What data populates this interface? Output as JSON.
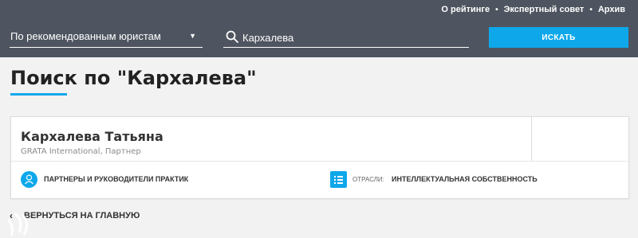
{
  "top_links": [
    "О рейтинге",
    "Экспертный совет",
    "Архив"
  ],
  "search_bar": {
    "filter_value": "По рекомендованным юристам",
    "query": "Кархалева",
    "button_label": "ИСКАТЬ"
  },
  "page_title": "Поиск по \"Кархалева\"",
  "results": [
    {
      "name": "Кархалева Татьяна",
      "company": "GRATA International, Партнер",
      "category": "ПАРТНЕРЫ И РУКОВОДИТЕЛИ ПРАКТИК",
      "industry_label": "ОТРАСЛИ:",
      "industry_value": "ИНТЕЛЛЕКТУАЛЬНАЯ СОБСТВЕННОСТЬ"
    }
  ],
  "back_link": "ВЕРНУТЬСЯ НА ГЛАВНУЮ",
  "icons": {
    "search": "search-icon",
    "caret": "chevron-down-icon",
    "category": "person-circle-icon",
    "industry": "list-icon",
    "back": "chevron-left-icon"
  },
  "colors": {
    "header_bg": "#4f5560",
    "accent": "#0ea8ea",
    "page_bg": "#f2f2f2"
  }
}
